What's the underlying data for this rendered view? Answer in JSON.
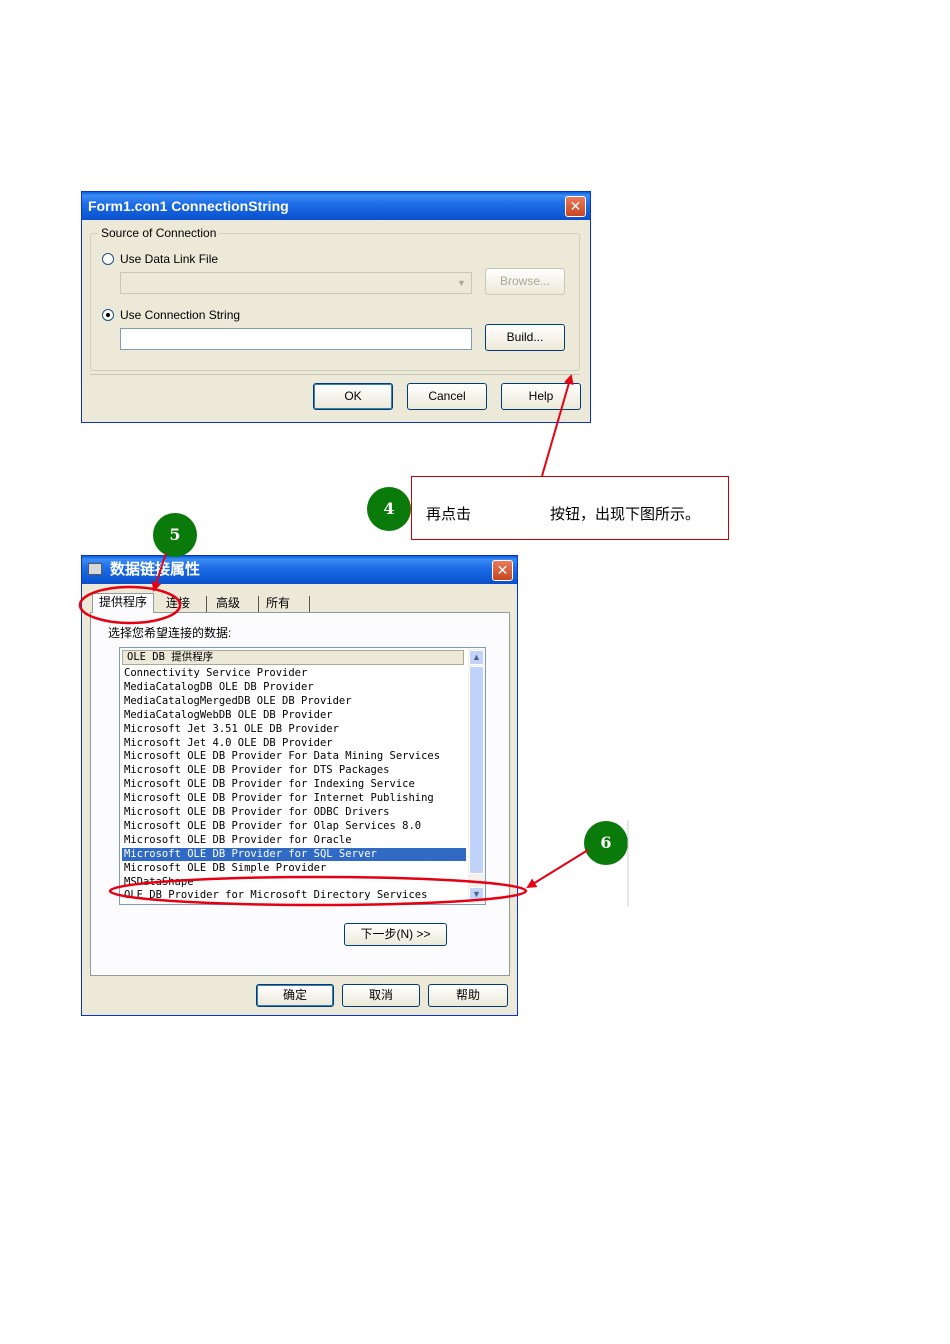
{
  "dialog1": {
    "title": "Form1.con1 ConnectionString",
    "close_glyph": "✕",
    "group_label": "Source of Connection",
    "option_link_file": "Use Data Link File",
    "browse_label": "Browse...",
    "option_conn_string": "Use Connection String",
    "build_label": "Build...",
    "ok_label": "OK",
    "cancel_label": "Cancel",
    "help_label": "Help",
    "conn_string_value": "",
    "link_file_value": ""
  },
  "annotation4": {
    "number": "4",
    "text_before": "再点击",
    "text_after": "按钮，出现下图所示。"
  },
  "annotation5": {
    "number": "5"
  },
  "annotation6": {
    "number": "6"
  },
  "dialog2": {
    "title": "数据链接属性",
    "close_glyph": "✕",
    "tabs": [
      {
        "label": "提供程序"
      },
      {
        "label": "连接"
      },
      {
        "label": "高级"
      },
      {
        "label": "所有"
      }
    ],
    "prompt": "选择您希望连接的数据:",
    "list_header": "OLE DB 提供程序",
    "providers": [
      "Connectivity Service Provider",
      "MediaCatalogDB OLE DB Provider",
      "MediaCatalogMergedDB OLE DB Provider",
      "MediaCatalogWebDB OLE DB Provider",
      "Microsoft Jet 3.51 OLE DB Provider",
      "Microsoft Jet 4.0 OLE DB Provider",
      "Microsoft OLE DB Provider For Data Mining Services",
      "Microsoft OLE DB Provider for DTS Packages",
      "Microsoft OLE DB Provider for Indexing Service",
      "Microsoft OLE DB Provider for Internet Publishing",
      "Microsoft OLE DB Provider for ODBC Drivers",
      "Microsoft OLE DB Provider for Olap Services 8.0",
      "Microsoft OLE DB Provider for Oracle",
      "Microsoft OLE DB Provider for SQL Server",
      "Microsoft OLE DB Simple Provider",
      "MSDataShape",
      "OLE DB Provider for Microsoft Directory Services"
    ],
    "selected_index": 13,
    "next_label": "下一步(N) >>",
    "ok_label": "确定",
    "cancel_label": "取消",
    "help_label": "帮助"
  },
  "colors": {
    "annotation_red": "#e60012",
    "badge_green": "#0a7a0a",
    "selection_blue": "#316ac5",
    "title_blue": "#0a5fd8"
  }
}
